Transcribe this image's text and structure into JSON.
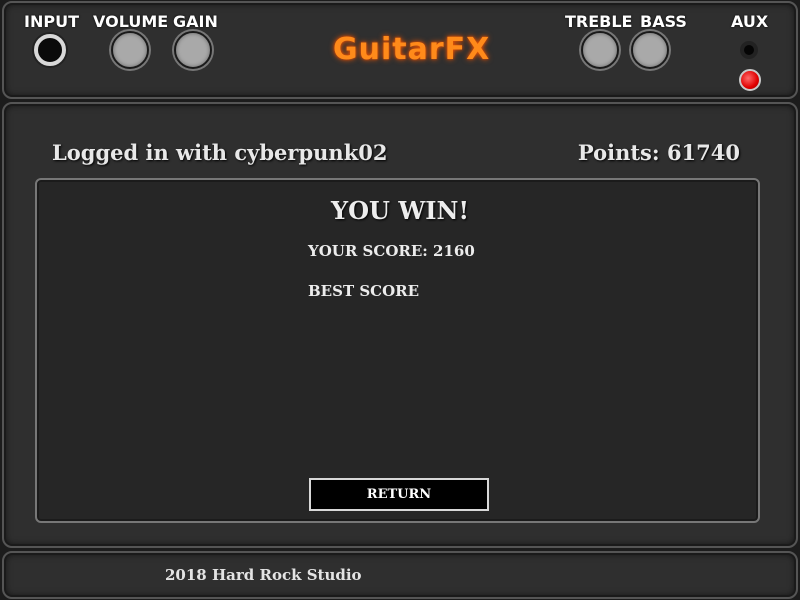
{
  "brand": {
    "title": "GuitarFX",
    "color": "#ff8a1a"
  },
  "controls": {
    "input_label": "INPUT",
    "volume_label": "VOLUME",
    "gain_label": "GAIN",
    "treble_label": "TREBLE",
    "bass_label": "BASS",
    "aux_label": "AUX",
    "led_color": "#e00000"
  },
  "session": {
    "logged_in_text": "Logged in with cyberpunk02",
    "points_text": "Points: 61740"
  },
  "result": {
    "title": "YOU WIN!",
    "your_score_text": "YOUR SCORE: 2160",
    "best_score_text": "BEST SCORE",
    "return_label": "RETURN"
  },
  "footer": {
    "copyright": "2018 Hard Rock Studio"
  }
}
